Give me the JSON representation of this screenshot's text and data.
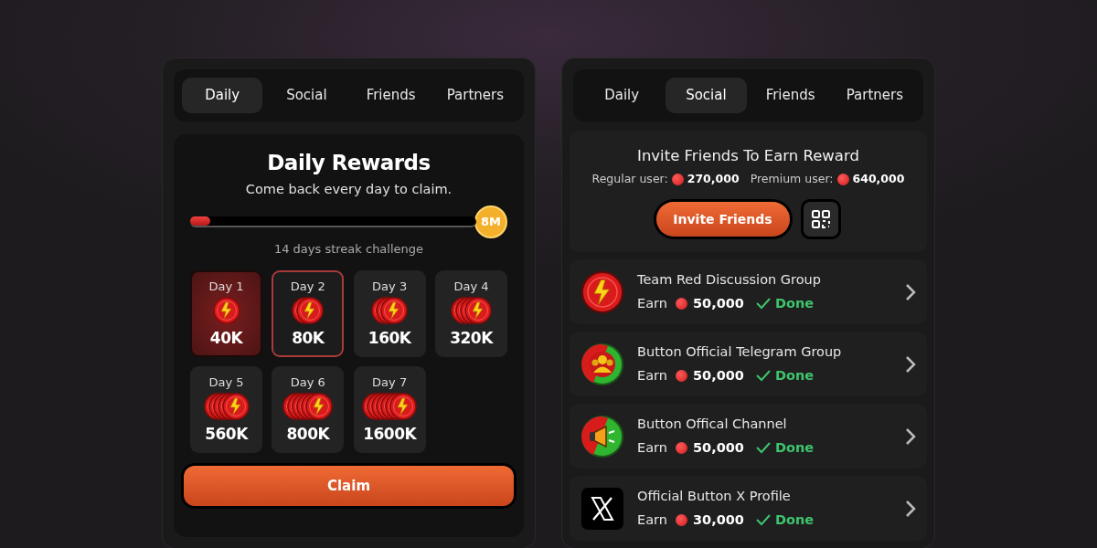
{
  "daily_panel": {
    "tabs": [
      {
        "label": "Daily",
        "selected": true
      },
      {
        "label": "Social",
        "selected": false
      },
      {
        "label": "Friends",
        "selected": false
      },
      {
        "label": "Partners",
        "selected": false
      }
    ],
    "title": "Daily Rewards",
    "subtitle": "Come back every day to claim.",
    "streak": {
      "level": 0.07,
      "goal": "8M",
      "caption": "14 days streak challenge"
    },
    "days": [
      {
        "label": "Day 1",
        "amount": "40K",
        "claimed": true,
        "selected": false
      },
      {
        "label": "Day 2",
        "amount": "80K",
        "claimed": false,
        "selected": true
      },
      {
        "label": "Day 3",
        "amount": "160K",
        "claimed": false,
        "selected": false
      },
      {
        "label": "Day 4",
        "amount": "320K",
        "claimed": false,
        "selected": false
      },
      {
        "label": "Day 5",
        "amount": "560K",
        "claimed": false,
        "selected": false
      },
      {
        "label": "Day 6",
        "amount": "800K",
        "claimed": false,
        "selected": false
      },
      {
        "label": "Day 7",
        "amount": "1600K",
        "claimed": false,
        "selected": false
      }
    ],
    "claim_button": "Claim"
  },
  "social_panel": {
    "tabs": [
      {
        "label": "Daily",
        "selected": false
      },
      {
        "label": "Social",
        "selected": true
      },
      {
        "label": "Friends",
        "selected": false
      },
      {
        "label": "Partners",
        "selected": false
      }
    ],
    "invite": {
      "title": "Invite Friends To Earn Reward",
      "regular_label": "Regular user:",
      "regular_amount": "270,000",
      "premium_label": "Premium user:",
      "premium_amount": "640,000",
      "button": "Invite Friends"
    },
    "tasks": [
      {
        "kind": "bolt",
        "name": "Team Red Discussion Group",
        "earn_label": "Earn",
        "amount": "50,000",
        "status": "Done",
        "done": true
      },
      {
        "kind": "group",
        "name": "Button Official Telegram Group",
        "earn_label": "Earn",
        "amount": "50,000",
        "status": "Done",
        "done": true
      },
      {
        "kind": "megaphone",
        "name": "Button Offical Channel",
        "earn_label": "Earn",
        "amount": "50,000",
        "status": "Done",
        "done": true
      },
      {
        "kind": "x",
        "name": "Official Button X Profile",
        "earn_label": "Earn",
        "amount": "30,000",
        "status": "Done",
        "done": true
      }
    ]
  }
}
